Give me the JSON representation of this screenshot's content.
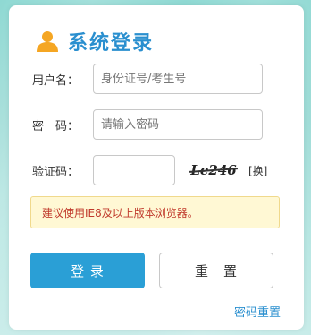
{
  "title": "系统登录",
  "colors": {
    "accent": "#2a8fcf",
    "primary_button": "#2a9fd6",
    "user_icon": "#f5a623",
    "notice_bg": "#fff8d4",
    "notice_text": "#c0392b"
  },
  "icons": {
    "title_icon": "user-icon"
  },
  "form": {
    "username": {
      "label": "用户名：",
      "value": "",
      "placeholder": "身份证号/考生号"
    },
    "password": {
      "label": "密　码：",
      "value": "",
      "placeholder": "请输入密码"
    },
    "captcha": {
      "label": "验证码：",
      "value": "",
      "placeholder": "",
      "image_text": "Le246",
      "refresh_label": "[换]"
    }
  },
  "notice": "建议使用IE8及以上版本浏览器。",
  "buttons": {
    "login": "登 录",
    "reset": "重　置"
  },
  "links": {
    "reset_password": "密码重置"
  }
}
